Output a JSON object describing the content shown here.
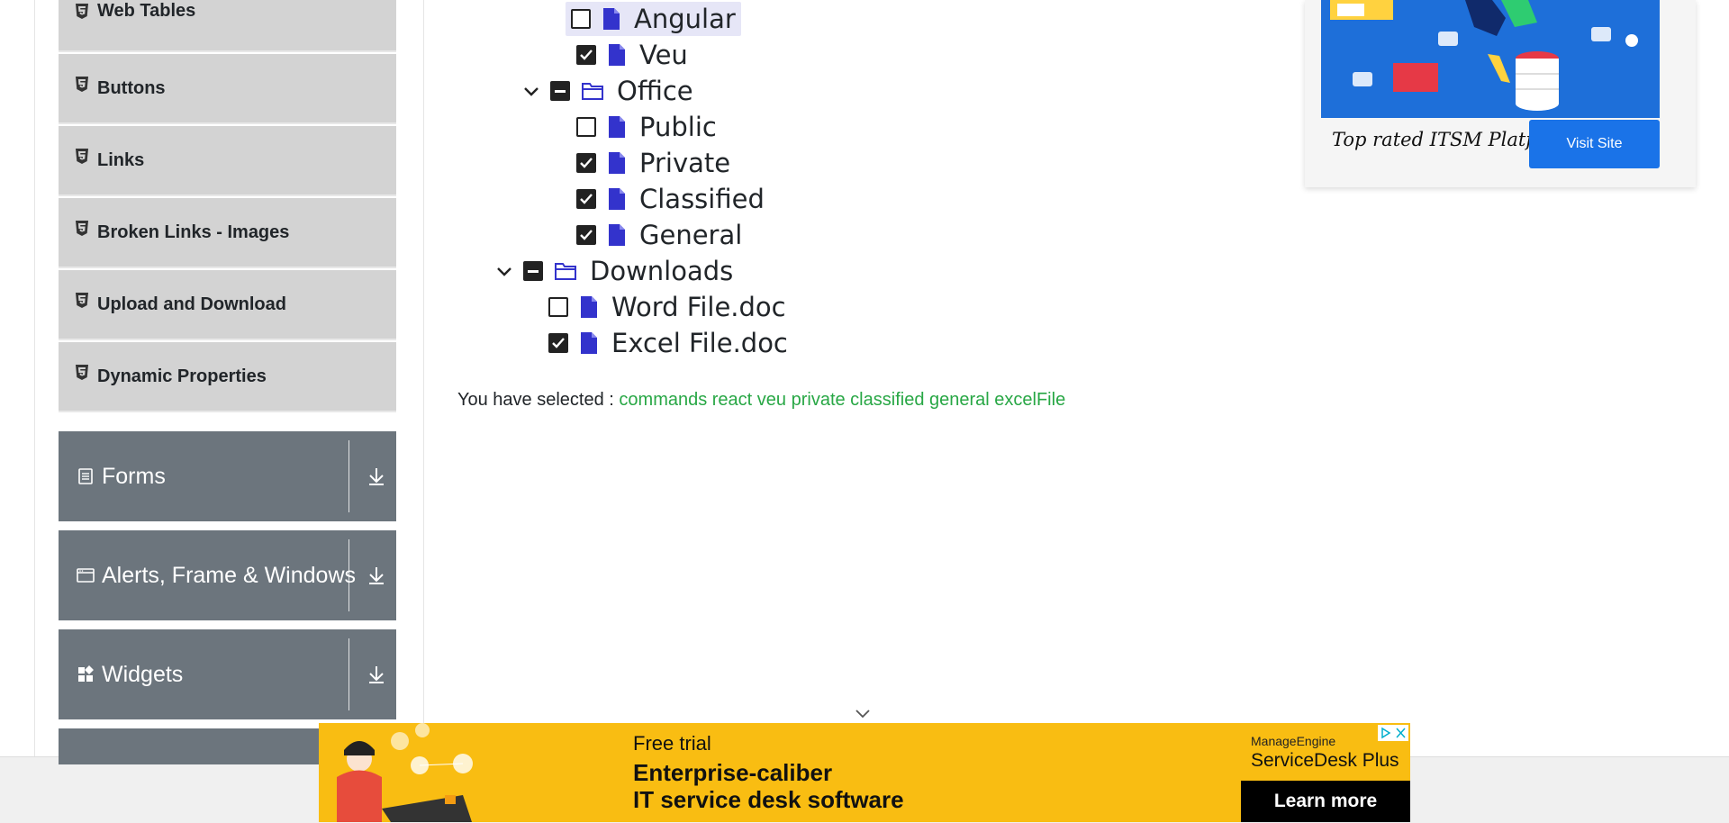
{
  "sidebar": {
    "items": [
      {
        "label": "Web Tables"
      },
      {
        "label": "Buttons"
      },
      {
        "label": "Links"
      },
      {
        "label": "Broken Links - Images"
      },
      {
        "label": "Upload and Download"
      },
      {
        "label": "Dynamic Properties"
      }
    ],
    "groups": [
      {
        "label": "Forms"
      },
      {
        "label": "Alerts, Frame & Windows"
      },
      {
        "label": "Widgets"
      }
    ]
  },
  "tree": {
    "nodes": [
      {
        "label": "Angular",
        "checked": false
      },
      {
        "label": "Veu",
        "checked": true
      },
      {
        "label": "Office",
        "checked": "partial"
      },
      {
        "label": "Public",
        "checked": false
      },
      {
        "label": "Private",
        "checked": true
      },
      {
        "label": "Classified",
        "checked": true
      },
      {
        "label": "General",
        "checked": true
      },
      {
        "label": "Downloads",
        "checked": "partial"
      },
      {
        "label": "Word File.doc",
        "checked": false
      },
      {
        "label": "Excel File.doc",
        "checked": true
      }
    ]
  },
  "result": {
    "prefix": "You have selected :",
    "values": "commands react veu private classified general excelFile"
  },
  "ad_top": {
    "tagline": "Top rated ITSM Platform",
    "button": "Visit Site"
  },
  "ad_bottom": {
    "line1": "Free trial",
    "line2": "Enterprise-caliber",
    "line3": "IT service desk software",
    "brand_small": "ManageEngine",
    "brand_big": "ServiceDesk Plus",
    "button": "Learn more"
  },
  "colors": {
    "selected_text": "#28a745",
    "group_bg": "#6c757d",
    "menu_bg": "#d3d3d3",
    "file_icon": "#3333cc",
    "ad_yellow": "#f9bd12",
    "ad_blue": "#1a73e8"
  },
  "icons": {
    "menu_item": "html5-icon",
    "file": "file-icon",
    "folder": "folder-icon",
    "caret": "chevron-down-icon",
    "group_arrow": "download-arrow-icon"
  }
}
